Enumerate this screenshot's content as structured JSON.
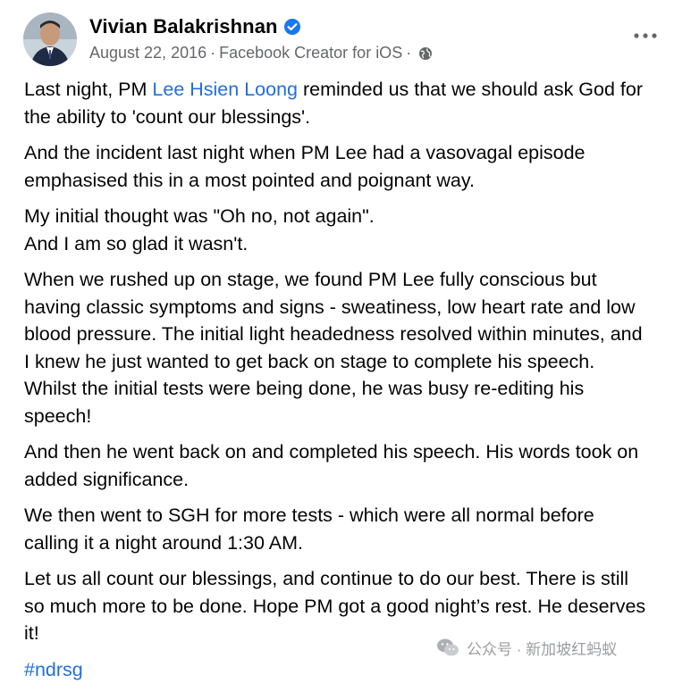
{
  "post": {
    "author": "Vivian Balakrishnan",
    "date": "August 22, 2016",
    "meta_sep": "·",
    "source": "Facebook Creator for iOS",
    "paragraphs": [
      {
        "pre": "Last night, PM ",
        "link": "Lee Hsien Loong",
        "post": " reminded us that we should ask God for the ability to 'count our blessings'."
      },
      {
        "text": "And the incident last night when PM Lee had a vasovagal episode emphasised this in a most pointed and poignant way."
      },
      {
        "line1": "My initial thought was \"Oh no, not again\".",
        "line2": "And I am so glad it wasn't."
      },
      {
        "text": "When we rushed up on stage, we found PM Lee fully conscious but having classic symptoms and signs - sweatiness, low heart rate and low blood pressure. The initial light headedness resolved within minutes, and I knew he just wanted to get back on stage to complete his speech. Whilst the initial tests were being done, he was busy re-editing his speech!"
      },
      {
        "text": "And then he went back on and completed his speech. His words took on added significance."
      },
      {
        "text": "We then went to SGH for more tests - which were all normal before calling it a night around 1:30 AM."
      },
      {
        "text": "Let us all count our blessings, and continue to do our best. There is still so much more to be done. Hope PM got a good night’s rest. He deserves it!"
      }
    ],
    "hashtag": "#ndrsg"
  },
  "watermark": {
    "text": "公众号 · 新加坡红蚂蚁"
  },
  "icons": {
    "verified": "verified-badge-icon",
    "privacy": "globe-icon",
    "more": "more-options-icon"
  },
  "colors": {
    "link": "#216fdb",
    "verified": "#1877f2",
    "meta": "#65676b"
  }
}
